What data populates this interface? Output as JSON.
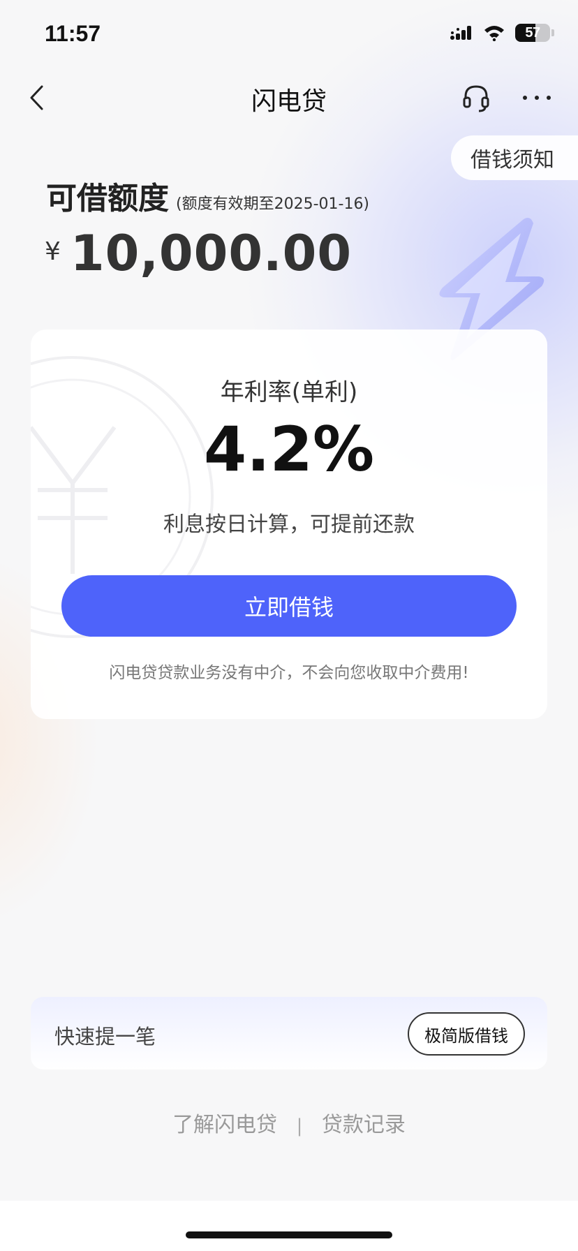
{
  "status_bar": {
    "time": "11:57",
    "battery": "57"
  },
  "nav": {
    "title": "闪电贷",
    "back_icon": "chevron-left-icon",
    "service_icon": "headset-icon",
    "more_icon": "more-dots-icon"
  },
  "notice": {
    "label": "借钱须知"
  },
  "quota": {
    "title": "可借额度",
    "expiry": "(额度有效期至2025-01-16)",
    "currency": "¥",
    "amount": "10,000.00"
  },
  "rate_card": {
    "rate_label": "年利率(单利)",
    "rate_value": "4.2%",
    "description": "利息按日计算，可提前还款",
    "button_label": "立即借钱",
    "warning": "闪电贷贷款业务没有中介，不会向您收取中介费用!"
  },
  "quick": {
    "label": "快速提一笔",
    "button_label": "极简版借钱"
  },
  "footer": {
    "link_about": "了解闪电贷",
    "separator": "|",
    "link_records": "贷款记录"
  },
  "colors": {
    "accent": "#4e63fa",
    "background": "#f7f7f8"
  }
}
